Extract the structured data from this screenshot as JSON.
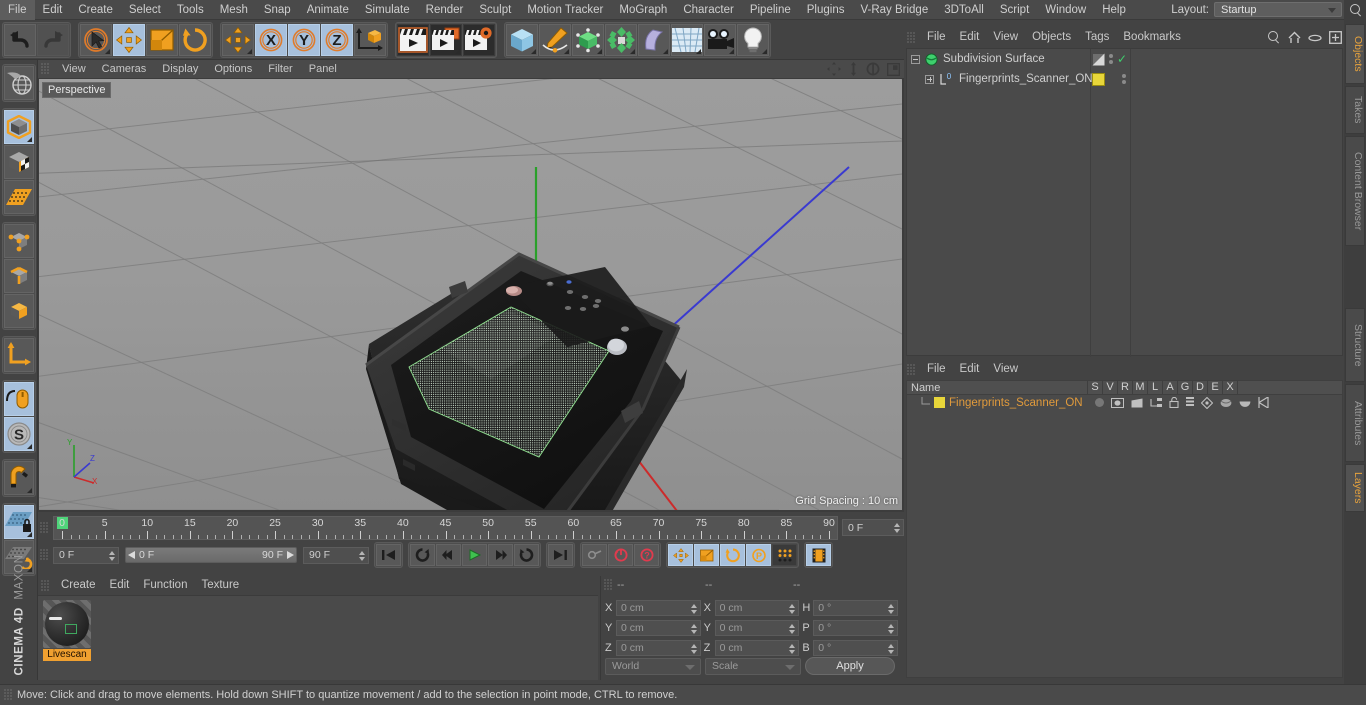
{
  "app": {
    "brand_top": "MAXON",
    "brand_bottom": "CINEMA 4D"
  },
  "menubar": {
    "items": [
      "File",
      "Edit",
      "Create",
      "Select",
      "Tools",
      "Mesh",
      "Snap",
      "Animate",
      "Simulate",
      "Render",
      "Sculpt",
      "Motion Tracker",
      "MoGraph",
      "Character",
      "Pipeline",
      "Plugins",
      "V-Ray Bridge",
      "3DToAll",
      "Script",
      "Window",
      "Help"
    ],
    "layout_label": "Layout:",
    "layout_value": "Startup",
    "search_icon": "magnify-icon"
  },
  "toolbar": {
    "groups": [
      {
        "name": "undo-redo",
        "buttons": [
          {
            "name": "undo-button",
            "icon": "undo-arrow-icon",
            "state": "normal"
          },
          {
            "name": "redo-button",
            "icon": "redo-arrow-icon",
            "state": "disabled"
          }
        ]
      },
      {
        "name": "transform-tools",
        "buttons": [
          {
            "name": "select-tool",
            "icon": "live-selection-icon",
            "state": "normal"
          },
          {
            "name": "move-tool",
            "icon": "move-arrows-icon",
            "state": "selected"
          },
          {
            "name": "scale-tool",
            "icon": "scale-box-icon",
            "state": "normal"
          },
          {
            "name": "rotate-tool",
            "icon": "rotate-circle-icon",
            "state": "normal"
          }
        ]
      },
      {
        "name": "axis-locks",
        "buttons": [
          {
            "name": "move-duplicate-tool",
            "icon": "move-arrows-icon",
            "state": "normal"
          },
          {
            "name": "lock-x-axis",
            "icon": "x-axis-icon",
            "label": "X",
            "state": "selected"
          },
          {
            "name": "lock-y-axis",
            "icon": "y-axis-icon",
            "label": "Y",
            "state": "selected"
          },
          {
            "name": "lock-z-axis",
            "icon": "z-axis-icon",
            "label": "Z",
            "state": "selected"
          },
          {
            "name": "world-object-coordinates",
            "icon": "world-axis-cube-icon",
            "state": "normal"
          }
        ]
      },
      {
        "name": "render-tools",
        "buttons": [
          {
            "name": "render-view",
            "icon": "clapper-icon",
            "state": "dark"
          },
          {
            "name": "render-to-picture-viewer",
            "icon": "clapper-picture-icon",
            "state": "dark"
          },
          {
            "name": "render-settings",
            "icon": "clapper-gear-icon",
            "state": "dark"
          }
        ]
      },
      {
        "name": "create-objects",
        "buttons": [
          {
            "name": "add-cube-object",
            "icon": "blue-cube-icon",
            "state": "normal"
          },
          {
            "name": "add-spline",
            "icon": "pen-spline-icon",
            "state": "normal"
          },
          {
            "name": "add-generator",
            "icon": "green-cube-icon",
            "state": "normal"
          },
          {
            "name": "add-mograph",
            "icon": "cloner-icon",
            "state": "normal"
          },
          {
            "name": "add-deformer",
            "icon": "bend-deformer-icon",
            "state": "normal"
          },
          {
            "name": "add-environment",
            "icon": "floor-grid-icon",
            "state": "normal"
          },
          {
            "name": "add-camera",
            "icon": "camera-icon",
            "state": "normal"
          },
          {
            "name": "add-light",
            "icon": "lightbulb-icon",
            "state": "normal"
          }
        ]
      }
    ]
  },
  "left_toolbar": {
    "buttons": [
      {
        "name": "viewport-navigation",
        "icon": "globe-navigation-icon",
        "state": "normal"
      },
      {
        "name": "model-mode",
        "icon": "model-cube-icon",
        "state": "selected"
      },
      {
        "name": "texture-mode",
        "icon": "texture-checker-cube-icon",
        "state": "normal"
      },
      {
        "name": "uv-mesh-mode",
        "icon": "uv-grid-icon",
        "state": "normal"
      },
      {
        "name": "points-mode",
        "icon": "points-cube-icon",
        "state": "normal"
      },
      {
        "name": "edges-mode",
        "icon": "edges-cube-icon",
        "state": "normal"
      },
      {
        "name": "polygons-mode",
        "icon": "polygon-cube-icon",
        "state": "normal"
      },
      {
        "name": "object-axis-mode",
        "icon": "axis-l-icon",
        "state": "normal"
      },
      {
        "name": "enable-axis-modification",
        "icon": "mouse-axis-icon",
        "state": "selected"
      },
      {
        "name": "soft-selection",
        "icon": "soft-selection-s-icon",
        "state": "selected"
      },
      {
        "name": "enable-snapping",
        "icon": "magnet-icon",
        "state": "normal"
      },
      {
        "name": "lock-workplane",
        "icon": "workplane-lock-icon",
        "state": "selected"
      },
      {
        "name": "workplane-rotate",
        "icon": "workplane-rotate-icon",
        "state": "normal"
      }
    ]
  },
  "viewport": {
    "menu": [
      "View",
      "Cameras",
      "Display",
      "Options",
      "Filter",
      "Panel"
    ],
    "label": "Perspective",
    "grid_spacing": "Grid Spacing : 10 cm",
    "nav_icons": [
      "pan-icon",
      "zoom-icon",
      "rotate-icon",
      "maximize-icon"
    ]
  },
  "timeline": {
    "ruler_labels": [
      "0",
      "5",
      "10",
      "15",
      "20",
      "25",
      "30",
      "35",
      "40",
      "45",
      "50",
      "55",
      "60",
      "65",
      "70",
      "75",
      "80",
      "85",
      "90"
    ],
    "current_frame_badge": "0 F",
    "current_frame": "0 F",
    "range_start": "0 F",
    "range_end": "90 F",
    "max_frame": "90 F",
    "transport": [
      {
        "name": "go-to-start-button",
        "icon": "skip-start-icon"
      },
      {
        "name": "play-backwards-loop-button",
        "icon": "loop-back-icon"
      },
      {
        "name": "step-back-button",
        "icon": "step-back-icon"
      },
      {
        "name": "play-button",
        "icon": "play-icon"
      },
      {
        "name": "step-forward-button",
        "icon": "step-forward-icon"
      },
      {
        "name": "play-forward-loop-button",
        "icon": "loop-forward-icon"
      },
      {
        "name": "go-to-end-button",
        "icon": "skip-end-icon"
      }
    ],
    "record_tools": [
      {
        "name": "record-active-objects",
        "icon": "key-icon"
      },
      {
        "name": "autokeying-button",
        "icon": "record-circle-icon"
      },
      {
        "name": "keyframe-selection-button",
        "icon": "question-circle-icon"
      }
    ],
    "key_toggles": [
      {
        "name": "position-key-toggle",
        "icon": "move-arrows-icon"
      },
      {
        "name": "scale-key-toggle",
        "icon": "scale-box-icon"
      },
      {
        "name": "rotation-key-toggle",
        "icon": "rotate-circle-icon"
      },
      {
        "name": "param-key-toggle",
        "icon": "p-circle-icon"
      },
      {
        "name": "point-level-animation-toggle",
        "icon": "dots-grid-icon"
      }
    ],
    "filmstrip_button": {
      "name": "timeline-filmstrip-button",
      "icon": "filmstrip-icon"
    }
  },
  "material_manager": {
    "menu": [
      "Create",
      "Edit",
      "Function",
      "Texture"
    ],
    "materials": [
      {
        "name": "Livescan",
        "preview": "dark-sphere-preview"
      }
    ]
  },
  "coordinates": {
    "headers": [
      "--",
      "--",
      "--"
    ],
    "rows": [
      {
        "label1": "X",
        "value1": "0 cm",
        "label2": "X",
        "value2": "0 cm",
        "label3": "H",
        "value3": "0 °"
      },
      {
        "label1": "Y",
        "value1": "0 cm",
        "label2": "Y",
        "value2": "0 cm",
        "label3": "P",
        "value3": "0 °"
      },
      {
        "label1": "Z",
        "value1": "0 cm",
        "label2": "Z",
        "value2": "0 cm",
        "label3": "B",
        "value3": "0 °"
      }
    ],
    "space_dropdown": "World",
    "mode_dropdown": "Scale",
    "apply_label": "Apply"
  },
  "object_manager": {
    "menu": [
      "File",
      "Edit",
      "View",
      "Objects",
      "Tags",
      "Bookmarks"
    ],
    "header_icons": [
      "search-icon",
      "home-icon",
      "ellipse-icon",
      "plus-box-icon"
    ],
    "items": [
      {
        "name": "Subdivision Surface",
        "icon": "subdivision-surface-icon",
        "depth": 0,
        "tag": "display-tag",
        "check": "✓"
      },
      {
        "name": "Fingerprints_Scanner_ON",
        "icon": "level-0-icon",
        "depth": 1,
        "tag": "yellow-material-tag",
        "check": ""
      }
    ]
  },
  "layer_manager": {
    "menu": [
      "File",
      "Edit",
      "View"
    ],
    "name_column": "Name",
    "columns": [
      "S",
      "V",
      "R",
      "M",
      "L",
      "A",
      "G",
      "D",
      "E",
      "X"
    ],
    "rows": [
      {
        "name": "Fingerprints_Scanner_ON",
        "color": "#e8d63a"
      }
    ]
  },
  "side_tabs": [
    {
      "label": "Objects",
      "active": true
    },
    {
      "label": "Takes",
      "active": false
    },
    {
      "label": "Content Browser",
      "active": false
    },
    {
      "label": "Structure",
      "active": false
    },
    {
      "label": "Attributes",
      "active": false
    },
    {
      "label": "Layers",
      "active": true
    }
  ],
  "status_bar": {
    "message": "Move: Click and drag to move elements. Hold down SHIFT to quantize movement / add to the selection in point mode, CTRL to remove."
  }
}
